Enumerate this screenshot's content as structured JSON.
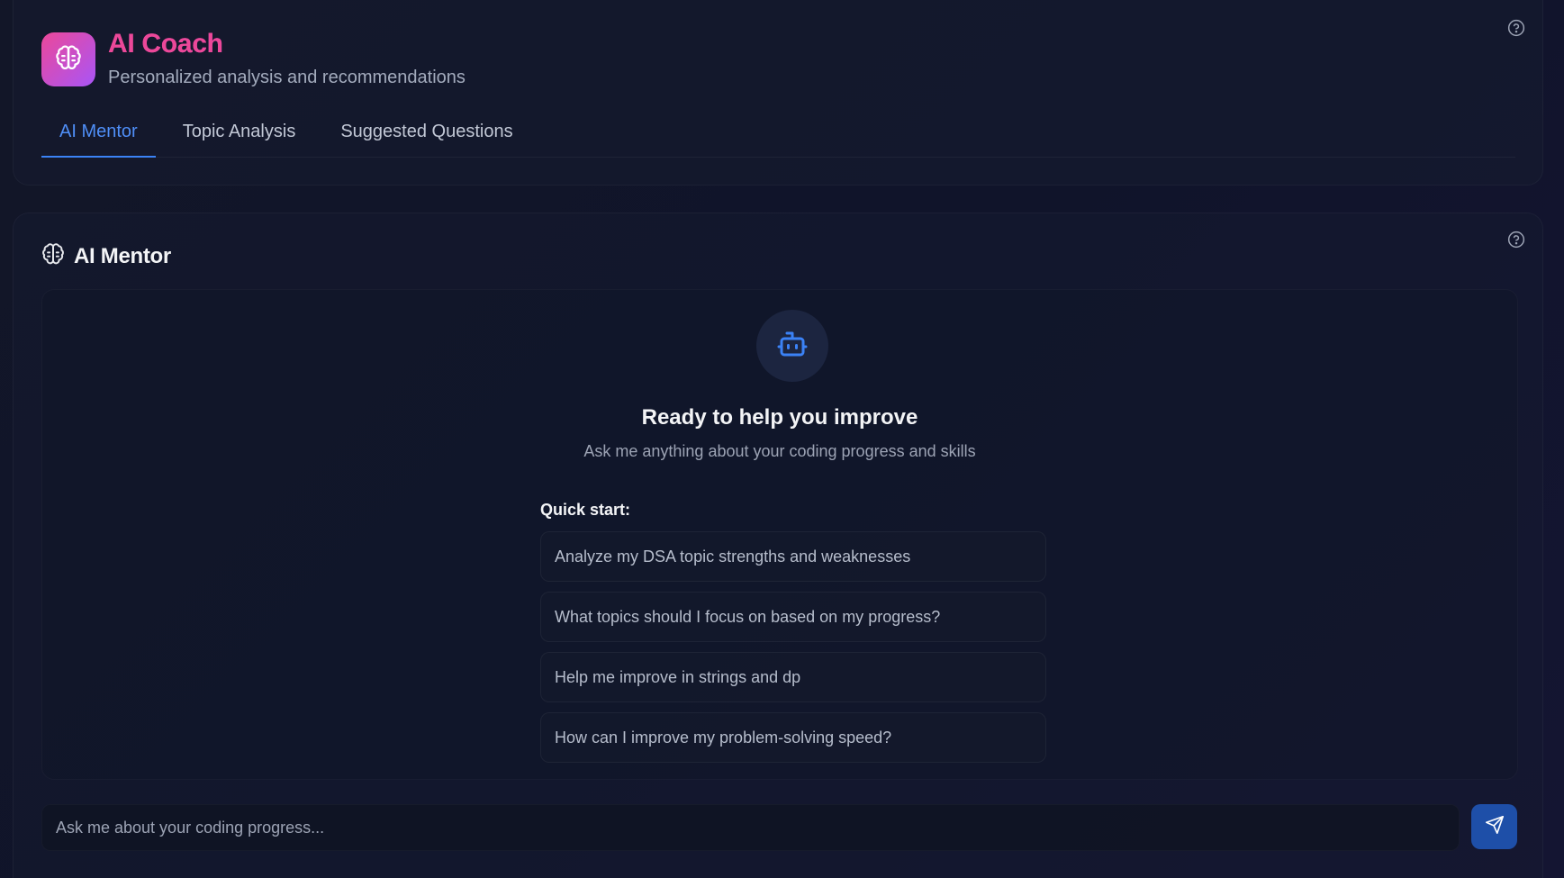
{
  "header": {
    "title": "AI Coach",
    "subtitle": "Personalized analysis and recommendations",
    "logo_icon": "brain-icon",
    "help_icon": "help-circle-icon"
  },
  "tabs": [
    {
      "label": "AI Mentor",
      "active": true
    },
    {
      "label": "Topic Analysis",
      "active": false
    },
    {
      "label": "Suggested Questions",
      "active": false
    }
  ],
  "mentor": {
    "title": "AI Mentor",
    "title_icon": "brain-icon",
    "help_icon": "help-circle-icon",
    "empty_state": {
      "icon": "bot-icon",
      "title": "Ready to help you improve",
      "subtitle": "Ask me anything about your coding progress and skills"
    },
    "quick_start_label": "Quick start:",
    "quick_start": [
      "Analyze my DSA topic strengths and weaknesses",
      "What topics should I focus on based on my progress?",
      "Help me improve in strings and dp",
      "How can I improve my problem-solving speed?"
    ],
    "input": {
      "placeholder": "Ask me about your coding progress...",
      "value": ""
    },
    "send_icon": "send-icon"
  },
  "colors": {
    "accent": "#3b82f6",
    "brand_pink": "#ec4899",
    "brand_purple": "#a855f7",
    "background": "#0f1322"
  }
}
